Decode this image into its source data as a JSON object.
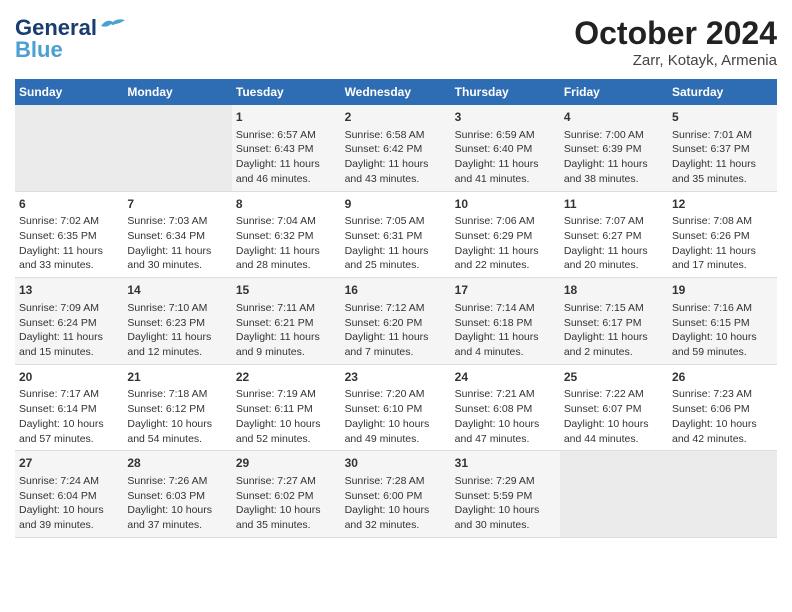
{
  "header": {
    "logo_line1": "General",
    "logo_line2": "Blue",
    "title": "October 2024",
    "subtitle": "Zarr, Kotayk, Armenia"
  },
  "days_of_week": [
    "Sunday",
    "Monday",
    "Tuesday",
    "Wednesday",
    "Thursday",
    "Friday",
    "Saturday"
  ],
  "weeks": [
    [
      {
        "day": "",
        "sunrise": "",
        "sunset": "",
        "daylight": "",
        "empty": true
      },
      {
        "day": "",
        "sunrise": "",
        "sunset": "",
        "daylight": "",
        "empty": true
      },
      {
        "day": "1",
        "sunrise": "Sunrise: 6:57 AM",
        "sunset": "Sunset: 6:43 PM",
        "daylight": "Daylight: 11 hours and 46 minutes."
      },
      {
        "day": "2",
        "sunrise": "Sunrise: 6:58 AM",
        "sunset": "Sunset: 6:42 PM",
        "daylight": "Daylight: 11 hours and 43 minutes."
      },
      {
        "day": "3",
        "sunrise": "Sunrise: 6:59 AM",
        "sunset": "Sunset: 6:40 PM",
        "daylight": "Daylight: 11 hours and 41 minutes."
      },
      {
        "day": "4",
        "sunrise": "Sunrise: 7:00 AM",
        "sunset": "Sunset: 6:39 PM",
        "daylight": "Daylight: 11 hours and 38 minutes."
      },
      {
        "day": "5",
        "sunrise": "Sunrise: 7:01 AM",
        "sunset": "Sunset: 6:37 PM",
        "daylight": "Daylight: 11 hours and 35 minutes."
      }
    ],
    [
      {
        "day": "6",
        "sunrise": "Sunrise: 7:02 AM",
        "sunset": "Sunset: 6:35 PM",
        "daylight": "Daylight: 11 hours and 33 minutes."
      },
      {
        "day": "7",
        "sunrise": "Sunrise: 7:03 AM",
        "sunset": "Sunset: 6:34 PM",
        "daylight": "Daylight: 11 hours and 30 minutes."
      },
      {
        "day": "8",
        "sunrise": "Sunrise: 7:04 AM",
        "sunset": "Sunset: 6:32 PM",
        "daylight": "Daylight: 11 hours and 28 minutes."
      },
      {
        "day": "9",
        "sunrise": "Sunrise: 7:05 AM",
        "sunset": "Sunset: 6:31 PM",
        "daylight": "Daylight: 11 hours and 25 minutes."
      },
      {
        "day": "10",
        "sunrise": "Sunrise: 7:06 AM",
        "sunset": "Sunset: 6:29 PM",
        "daylight": "Daylight: 11 hours and 22 minutes."
      },
      {
        "day": "11",
        "sunrise": "Sunrise: 7:07 AM",
        "sunset": "Sunset: 6:27 PM",
        "daylight": "Daylight: 11 hours and 20 minutes."
      },
      {
        "day": "12",
        "sunrise": "Sunrise: 7:08 AM",
        "sunset": "Sunset: 6:26 PM",
        "daylight": "Daylight: 11 hours and 17 minutes."
      }
    ],
    [
      {
        "day": "13",
        "sunrise": "Sunrise: 7:09 AM",
        "sunset": "Sunset: 6:24 PM",
        "daylight": "Daylight: 11 hours and 15 minutes."
      },
      {
        "day": "14",
        "sunrise": "Sunrise: 7:10 AM",
        "sunset": "Sunset: 6:23 PM",
        "daylight": "Daylight: 11 hours and 12 minutes."
      },
      {
        "day": "15",
        "sunrise": "Sunrise: 7:11 AM",
        "sunset": "Sunset: 6:21 PM",
        "daylight": "Daylight: 11 hours and 9 minutes."
      },
      {
        "day": "16",
        "sunrise": "Sunrise: 7:12 AM",
        "sunset": "Sunset: 6:20 PM",
        "daylight": "Daylight: 11 hours and 7 minutes."
      },
      {
        "day": "17",
        "sunrise": "Sunrise: 7:14 AM",
        "sunset": "Sunset: 6:18 PM",
        "daylight": "Daylight: 11 hours and 4 minutes."
      },
      {
        "day": "18",
        "sunrise": "Sunrise: 7:15 AM",
        "sunset": "Sunset: 6:17 PM",
        "daylight": "Daylight: 11 hours and 2 minutes."
      },
      {
        "day": "19",
        "sunrise": "Sunrise: 7:16 AM",
        "sunset": "Sunset: 6:15 PM",
        "daylight": "Daylight: 10 hours and 59 minutes."
      }
    ],
    [
      {
        "day": "20",
        "sunrise": "Sunrise: 7:17 AM",
        "sunset": "Sunset: 6:14 PM",
        "daylight": "Daylight: 10 hours and 57 minutes."
      },
      {
        "day": "21",
        "sunrise": "Sunrise: 7:18 AM",
        "sunset": "Sunset: 6:12 PM",
        "daylight": "Daylight: 10 hours and 54 minutes."
      },
      {
        "day": "22",
        "sunrise": "Sunrise: 7:19 AM",
        "sunset": "Sunset: 6:11 PM",
        "daylight": "Daylight: 10 hours and 52 minutes."
      },
      {
        "day": "23",
        "sunrise": "Sunrise: 7:20 AM",
        "sunset": "Sunset: 6:10 PM",
        "daylight": "Daylight: 10 hours and 49 minutes."
      },
      {
        "day": "24",
        "sunrise": "Sunrise: 7:21 AM",
        "sunset": "Sunset: 6:08 PM",
        "daylight": "Daylight: 10 hours and 47 minutes."
      },
      {
        "day": "25",
        "sunrise": "Sunrise: 7:22 AM",
        "sunset": "Sunset: 6:07 PM",
        "daylight": "Daylight: 10 hours and 44 minutes."
      },
      {
        "day": "26",
        "sunrise": "Sunrise: 7:23 AM",
        "sunset": "Sunset: 6:06 PM",
        "daylight": "Daylight: 10 hours and 42 minutes."
      }
    ],
    [
      {
        "day": "27",
        "sunrise": "Sunrise: 7:24 AM",
        "sunset": "Sunset: 6:04 PM",
        "daylight": "Daylight: 10 hours and 39 minutes."
      },
      {
        "day": "28",
        "sunrise": "Sunrise: 7:26 AM",
        "sunset": "Sunset: 6:03 PM",
        "daylight": "Daylight: 10 hours and 37 minutes."
      },
      {
        "day": "29",
        "sunrise": "Sunrise: 7:27 AM",
        "sunset": "Sunset: 6:02 PM",
        "daylight": "Daylight: 10 hours and 35 minutes."
      },
      {
        "day": "30",
        "sunrise": "Sunrise: 7:28 AM",
        "sunset": "Sunset: 6:00 PM",
        "daylight": "Daylight: 10 hours and 32 minutes."
      },
      {
        "day": "31",
        "sunrise": "Sunrise: 7:29 AM",
        "sunset": "Sunset: 5:59 PM",
        "daylight": "Daylight: 10 hours and 30 minutes."
      },
      {
        "day": "",
        "sunrise": "",
        "sunset": "",
        "daylight": "",
        "empty": true
      },
      {
        "day": "",
        "sunrise": "",
        "sunset": "",
        "daylight": "",
        "empty": true
      }
    ]
  ]
}
